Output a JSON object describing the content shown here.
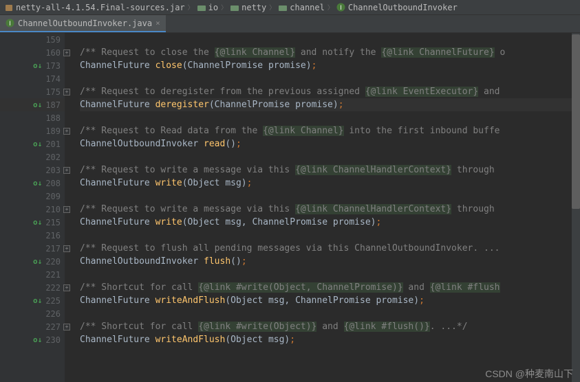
{
  "breadcrumb": {
    "jar": "netty-all-4.1.54.Final-sources.jar",
    "p1": "io",
    "p2": "netty",
    "p3": "channel",
    "cls": "ChannelOutboundInvoker"
  },
  "tab": {
    "label": "ChannelOutboundInvoker.java",
    "close": "×"
  },
  "lines": {
    "l159": "159",
    "l160": "160",
    "l173": "173",
    "l174": "174",
    "l175": "175",
    "l187": "187",
    "l188": "188",
    "l189": "189",
    "l201": "201",
    "l202": "202",
    "l203": "203",
    "l208": "208",
    "l209": "209",
    "l210": "210",
    "l215": "215",
    "l216": "216",
    "l217": "217",
    "l220": "220",
    "l221": "221",
    "l222": "222",
    "l225": "225",
    "l226": "226",
    "l227": "227",
    "l230": "230"
  },
  "ovr": "o↓",
  "fold_plus": "+",
  "code": {
    "c160a": "/** Request to close the ",
    "c160b": "{@link Channel}",
    "c160c": " and notify the ",
    "c160d": "{@link ChannelFuture}",
    "c160e": " o",
    "c173_typ": "ChannelFuture ",
    "c173_mth": "close",
    "c173_par": "(ChannelPromise promise)",
    "semi": ";",
    "c175a": "/** Request to deregister from the previous assigned ",
    "c175b": "{@link EventExecutor}",
    "c175c": " and ",
    "c187_typ": "ChannelFuture ",
    "c187_mth": "deregister",
    "c187_par": "(ChannelPromise promise)",
    "c189a": "/** Request to Read data from the ",
    "c189b": "{@link Channel}",
    "c189c": " into the first inbound buffe",
    "c201_typ": "ChannelOutboundInvoker ",
    "c201_mth": "read",
    "c201_par": "()",
    "c203a": "/** Request to write a message via this ",
    "c203b": "{@link ChannelHandlerContext}",
    "c203c": " through ",
    "c208_typ": "ChannelFuture ",
    "c208_mth": "write",
    "c208_par": "(Object msg)",
    "c210a": "/** Request to write a message via this ",
    "c210b": "{@link ChannelHandlerContext}",
    "c210c": " through ",
    "c215_typ": "ChannelFuture ",
    "c215_mth": "write",
    "c215_par": "(Object msg, ChannelPromise promise)",
    "c217a": "/** Request to flush all pending messages via this ChannelOutboundInvoker. ...",
    "c220_typ": "ChannelOutboundInvoker ",
    "c220_mth": "flush",
    "c220_par": "()",
    "c222a": "/** Shortcut for call ",
    "c222b": "{@link #write(Object, ChannelPromise)}",
    "c222c": " and ",
    "c222d": "{@link #flush",
    "c225_typ": "ChannelFuture ",
    "c225_mth": "writeAndFlush",
    "c225_par": "(Object msg, ChannelPromise promise)",
    "c227a": "/** Shortcut for call ",
    "c227b": "{@link #write(Object)}",
    "c227c": " and ",
    "c227d": "{@link #flush()}",
    "c227e": ". ...*/",
    "c230_typ": "ChannelFuture ",
    "c230_mth": "writeAndFlush",
    "c230_par": "(Object msg)"
  },
  "watermark": "CSDN @种麦南山下"
}
